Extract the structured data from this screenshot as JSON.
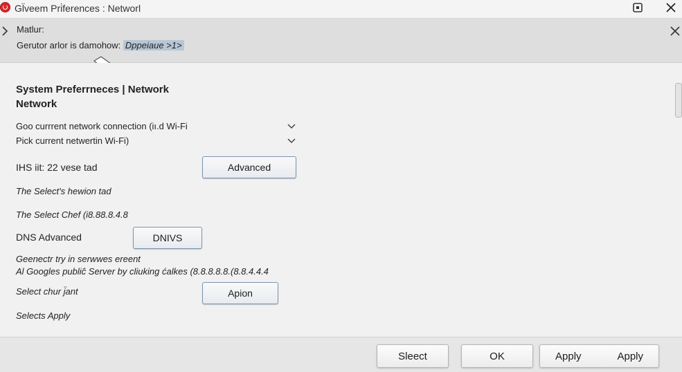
{
  "window": {
    "title": "Gl̈veem Pri̇ferences  : Networl",
    "app_icon": "app-logo-icon",
    "restore_icon": "restore-icon",
    "close_icon": "close-icon"
  },
  "banner": {
    "title": "Matlur:",
    "message": "Gerutor arlor is damohow: ",
    "message_highlight": "Dppeiaue >1>",
    "chevron_icon": "chevron-right-icon",
    "close_icon": "close-icon"
  },
  "main": {
    "heading_line1": "System Preferrneces  |  Network",
    "heading_line2": "Network",
    "dropdown_1": "Goo currrent network connection (iı.d Wi-Fi",
    "dropdown_2": "Pick current netwertin Wi-Fi)",
    "ip_label": "IHS  iit: 22 vese tad",
    "advanced_button": "Advanced",
    "select_hewion": "The Select's hewion tad",
    "select_chef": "The Select Chef (i8.88.8.4.8",
    "dns_label": "DNS Advanced",
    "dns_button": "DNIVS",
    "generic_line1": "Geenectr try in serwwes ereent",
    "generic_line2": "Al Googles publiĉ Server by cliuking ćalkes (8.8.8.8.8.(8.8.4.4.4",
    "select_chur": "Select chur j̈ant",
    "option_button": "Apion",
    "select_apply": "Selects Apply"
  },
  "footer": {
    "select_button": "Sleect",
    "ok_button": "OK",
    "apply_left": "Apply",
    "apply_right": "Apply"
  },
  "colors": {
    "app_icon": "#d9262b",
    "cursor_arrow": "#d21f26",
    "banner_bg": "#dedede",
    "highlight": "#b7c6d6",
    "button_border": "#7d93ad"
  }
}
